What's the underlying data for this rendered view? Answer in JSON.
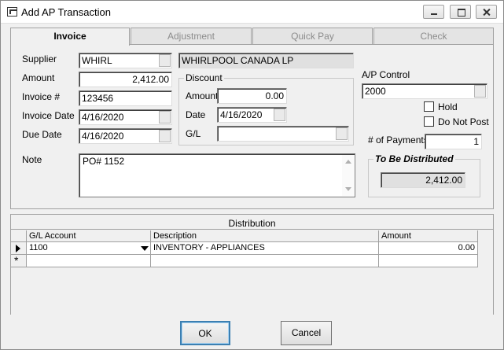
{
  "window": {
    "title": "Add AP Transaction"
  },
  "tabs": [
    "Invoice",
    "Adjustment",
    "Quick Pay",
    "Check"
  ],
  "invoice": {
    "supplier_label": "Supplier",
    "supplier_code": "WHIRL",
    "supplier_name": "WHIRLPOOL CANADA LP",
    "amount_label": "Amount",
    "amount": "2,412.00",
    "invoice_no_label": "Invoice #",
    "invoice_no": "123456",
    "invoice_date_label": "Invoice Date",
    "invoice_date": "4/16/2020",
    "due_date_label": "Due Date",
    "due_date": "4/16/2020",
    "note_label": "Note",
    "note": "PO# 1152"
  },
  "discount": {
    "title": "Discount",
    "amount_label": "Amount",
    "amount": "0.00",
    "date_label": "Date",
    "date": "4/16/2020",
    "gl_label": "G/L",
    "gl": ""
  },
  "ap": {
    "control_label": "A/P Control",
    "control": "2000",
    "hold_label": "Hold",
    "do_not_post_label": "Do Not Post",
    "payments_label": "# of Payments",
    "payments": "1",
    "to_be_distributed_label": "To Be Distributed",
    "to_be_distributed": "2,412.00"
  },
  "distribution": {
    "title": "Distribution",
    "columns": [
      "G/L Account",
      "Description",
      "Amount"
    ],
    "rows": [
      {
        "gl_account": "1100",
        "description": "INVENTORY - APPLIANCES",
        "amount": "0.00"
      }
    ]
  },
  "buttons": {
    "ok": "OK",
    "cancel": "Cancel"
  }
}
